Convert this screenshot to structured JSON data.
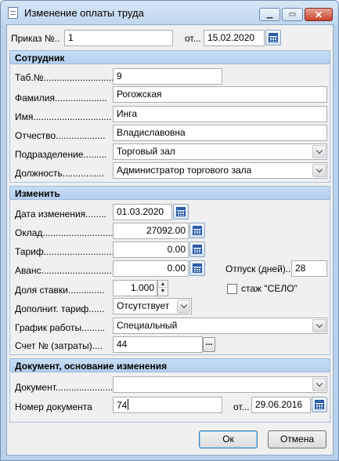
{
  "window": {
    "title": "Изменение оплаты труда",
    "minimize_glyph": "▁",
    "maximize_glyph": "▭",
    "close_glyph": "✕"
  },
  "order": {
    "number_label": "Приказ №..",
    "number_value": "1",
    "date_label": "от...",
    "date_value": "15.02.2020"
  },
  "employee": {
    "section_title": "Сотрудник",
    "tab_label": "Таб.№",
    "tab_dots": "...........................",
    "tab_value": "9",
    "lastname_label": "Фамилия",
    "lastname_dots": "....................",
    "lastname_value": "Рогожская",
    "firstname_label": "Имя",
    "firstname_dots": "..............................",
    "firstname_value": "Инга",
    "patronymic_label": "Отчество",
    "patronymic_dots": "...................",
    "patronymic_value": "Владиславовна",
    "department_label": "Подразделение",
    "department_dots": ".........",
    "department_value": "Торговый зал",
    "position_label": "Должность",
    "position_dots": "................",
    "position_value": "Администратор торгового зала"
  },
  "change": {
    "section_title": "Изменить",
    "date_label": "Дата изменения",
    "date_dots": "........",
    "date_value": "01.03.2020",
    "salary_label": "Оклад",
    "salary_dots": "...........................",
    "salary_value": "27092.00",
    "rate_label": "Тариф",
    "rate_dots": "...........................",
    "rate_value": "0.00",
    "advance_label": "Аванс",
    "advance_dots": "...........................",
    "advance_value": "0.00",
    "vacation_label": "Отпуск (дней)..",
    "vacation_value": "28",
    "share_label": "Доля ставки",
    "share_dots": "..............",
    "share_value": "1.000",
    "selo_label": "стаж \"СЕЛО\"",
    "extra_tariff_label": "Дополнит. тариф",
    "extra_tariff_dots": "......",
    "extra_tariff_value": "Отсутствует",
    "schedule_label": "График работы",
    "schedule_dots": ".........",
    "schedule_value": "Специальный",
    "account_label": "Счет № (затраты)....",
    "account_value": "44",
    "account_button": "..."
  },
  "document": {
    "section_title": "Документ, основание изменения",
    "doc_label": "Документ",
    "doc_dots": "...........................",
    "doc_value": "",
    "number_label": "Номер документа",
    "number_value": "74",
    "date_label": "от...",
    "date_value": "29.06.2016"
  },
  "buttons": {
    "ok": "Ок",
    "cancel": "Отмена"
  }
}
